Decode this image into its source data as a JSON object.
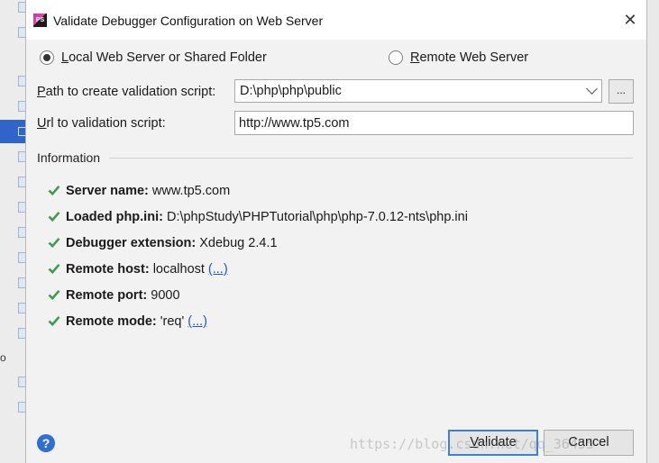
{
  "window": {
    "title": "Validate Debugger Configuration on Web Server",
    "icon_text": "PS"
  },
  "mode": {
    "local": {
      "label": "Local Web Server or Shared Folder",
      "mnemonic": "L",
      "rest": "ocal Web Server or Shared Folder",
      "selected": true
    },
    "remote": {
      "label": "Remote Web Server",
      "mnemonic": "R",
      "rest": "emote Web Server",
      "selected": false
    }
  },
  "form": {
    "path": {
      "label": "Path to create validation script:",
      "mnemonic": "P",
      "rest": "ath to create validation script:",
      "value": "D:\\php\\php\\public"
    },
    "browse_label": "...",
    "url": {
      "label": "Url to validation script:",
      "mnemonic": "U",
      "rest": "rl to validation script:",
      "value": "http://www.tp5.com"
    }
  },
  "information": {
    "heading": "Information",
    "items": [
      {
        "key": "Server name:",
        "value": "www.tp5.com",
        "link": ""
      },
      {
        "key": "Loaded php.ini:",
        "value": "D:\\phpStudy\\PHPTutorial\\php\\php-7.0.12-nts\\php.ini",
        "link": ""
      },
      {
        "key": "Debugger extension:",
        "value": "Xdebug 2.4.1",
        "link": ""
      },
      {
        "key": "Remote host:",
        "value": "localhost",
        "link": "(...)"
      },
      {
        "key": "Remote port:",
        "value": "9000",
        "link": ""
      },
      {
        "key": "Remote mode:",
        "value": "'req'",
        "link": "(...)"
      }
    ]
  },
  "buttons": {
    "help": "?",
    "validate": {
      "label": "Validate",
      "mnemonic": "V",
      "rest": "alidate"
    },
    "cancel": "Cancel"
  },
  "background": {
    "fragment_text": "o"
  },
  "watermark": "https://blog.csdn.net/qq_36455"
}
